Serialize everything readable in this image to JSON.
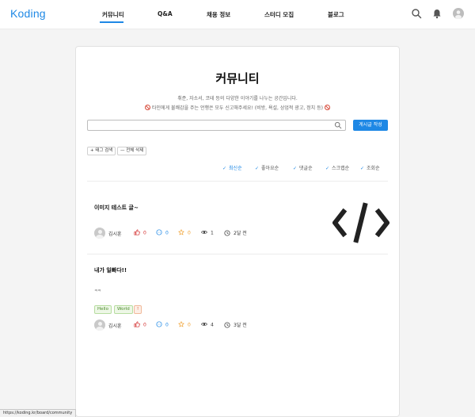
{
  "header": {
    "logo": "Koding",
    "nav": [
      "커뮤니티",
      "Q&A",
      "채용 정보",
      "스터디 모집",
      "블로그"
    ],
    "icons": [
      "search-icon",
      "bell-icon",
      "user-avatar-icon"
    ],
    "accent": "#1e88e5"
  },
  "page": {
    "title": "커뮤니티",
    "subtitle1": "취준, 자소서, 코테 등의 다양한 이야기를 나누는 공간입니다.",
    "subtitle2": "타인에게 불쾌감을 주는 언행은 모두 신고해주세요! (비방, 욕설, 상업적 광고, 정치 등)",
    "search_placeholder": "",
    "search_value": "",
    "write_button": "게시글 작성",
    "tag_search": "+ 태그 검색",
    "clear_all": "— 전체 삭제",
    "sort": [
      "최신순",
      "좋아요순",
      "댓글순",
      "스크랩순",
      "조회순"
    ],
    "active_sort": "최신순"
  },
  "posts": [
    {
      "title": "이미지 테스트 글~",
      "body": "",
      "author": "김시훈",
      "likes": "0",
      "comments": "0",
      "scraps": "0",
      "views": "1",
      "time": "2달 전",
      "tags": [],
      "thumbnail": "code-brackets-image"
    },
    {
      "title": "내가 일빠다!!",
      "body": "ㅋㅋ",
      "author": "김시훈",
      "likes": "0",
      "comments": "0",
      "scraps": "0",
      "views": "4",
      "time": "3달 전",
      "tags": [
        "Hello",
        "World",
        "!"
      ]
    }
  ],
  "statusbar": {
    "url": "https://koding.kr/board/community"
  }
}
